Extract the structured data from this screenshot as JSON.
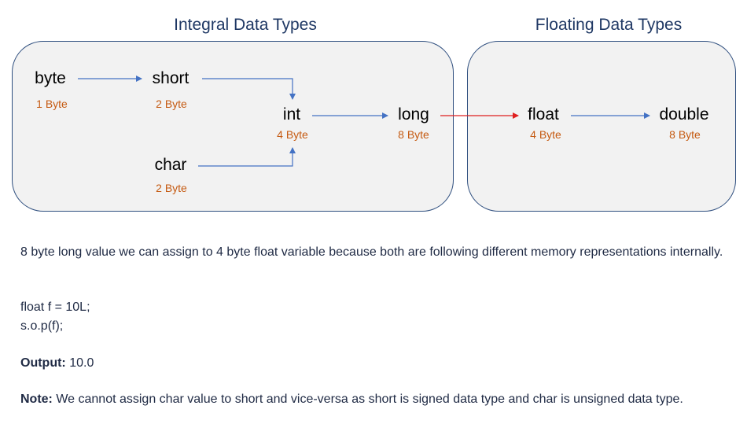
{
  "diagram": {
    "integral_title": "Integral Data Types",
    "floating_title": "Floating Data Types",
    "types": {
      "byte": {
        "name": "byte",
        "size": "1 Byte"
      },
      "short": {
        "name": "short",
        "size": "2 Byte"
      },
      "char": {
        "name": "char",
        "size": "2 Byte"
      },
      "int": {
        "name": "int",
        "size": "4 Byte"
      },
      "long": {
        "name": "long",
        "size": "8 Byte"
      },
      "float": {
        "name": "float",
        "size": "4 Byte"
      },
      "double": {
        "name": "double",
        "size": "8 Byte"
      }
    },
    "colors": {
      "arrow": "#4472c4",
      "highlight_arrow": "#e02020",
      "box_border": "#2f4f7f",
      "box_fill": "#f2f2f2",
      "size_text": "#c55a11",
      "title_text": "#1f3864"
    }
  },
  "text": {
    "description": "8 byte long value we can assign to 4 byte float variable because both are following different memory representations internally.",
    "code_line1": "float f = 10L;",
    "code_line2": "s.o.p(f);",
    "output_label": "Output:",
    "output_value": " 10.0",
    "note_label": "Note:",
    "note_text": " We cannot assign char value to short and vice-versa as short is signed data type and char is unsigned data type."
  }
}
